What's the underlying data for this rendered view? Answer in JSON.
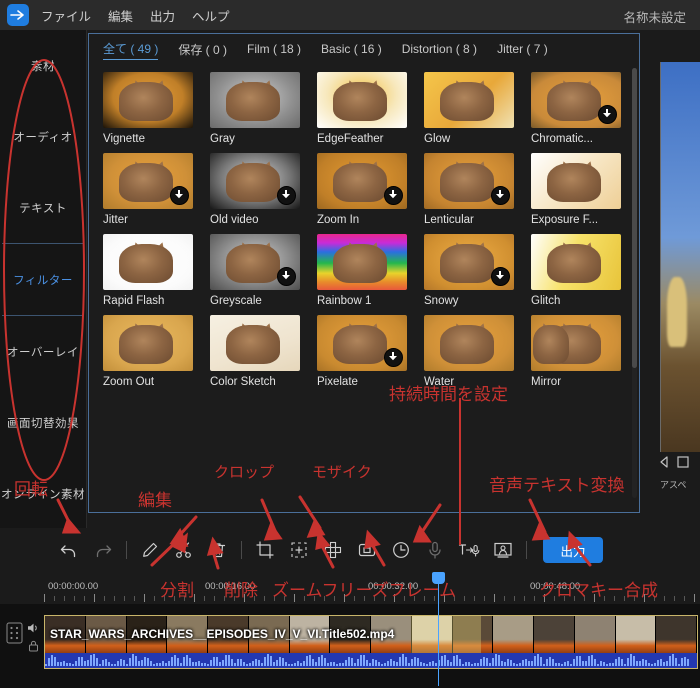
{
  "menubar": {
    "logo_icon": "app-logo-icon",
    "items": [
      "ファイル",
      "編集",
      "出力",
      "ヘルプ"
    ],
    "window_title": "名称未設定"
  },
  "sidebar": {
    "items": [
      {
        "label": "素材",
        "active": false
      },
      {
        "label": "オーディオ",
        "active": false
      },
      {
        "label": "テキスト",
        "active": false
      },
      {
        "label": "フィルター",
        "active": true
      },
      {
        "label": "オーバーレイ",
        "active": false
      },
      {
        "label": "画面切替効果",
        "active": false
      },
      {
        "label": "オンライン素材",
        "active": false
      }
    ]
  },
  "panel": {
    "tabs": [
      {
        "label": "全て ( 49 )",
        "active": true
      },
      {
        "label": "保存 ( 0 )",
        "active": false
      },
      {
        "label": "Film ( 18 )",
        "active": false
      },
      {
        "label": "Basic ( 16 )",
        "active": false
      },
      {
        "label": "Distortion ( 8 )",
        "active": false
      },
      {
        "label": "Jitter ( 7 )",
        "active": false
      }
    ],
    "filters": [
      {
        "label": "Vignette",
        "download": false,
        "style": "vignette"
      },
      {
        "label": "Gray",
        "download": false,
        "style": "gray"
      },
      {
        "label": "EdgeFeather",
        "download": false,
        "style": "edgefeather"
      },
      {
        "label": "Glow",
        "download": false,
        "style": "glow"
      },
      {
        "label": "Chromatic...",
        "download": true,
        "style": "chromatic"
      },
      {
        "label": "Jitter",
        "download": true,
        "style": "jitter"
      },
      {
        "label": "Old video",
        "download": true,
        "style": "oldvideo"
      },
      {
        "label": "Zoom In",
        "download": true,
        "style": "zoomin"
      },
      {
        "label": "Lenticular",
        "download": true,
        "style": "lenticular"
      },
      {
        "label": "Exposure F...",
        "download": false,
        "style": "exposure"
      },
      {
        "label": "Rapid Flash",
        "download": false,
        "style": "rapidflash"
      },
      {
        "label": "Greyscale",
        "download": true,
        "style": "greyscale"
      },
      {
        "label": "Rainbow 1",
        "download": false,
        "style": "rainbow"
      },
      {
        "label": "Snowy",
        "download": true,
        "style": "snowy"
      },
      {
        "label": "Glitch",
        "download": false,
        "style": "glitch"
      },
      {
        "label": "Zoom Out",
        "download": false,
        "style": "zoomout"
      },
      {
        "label": "Color Sketch",
        "download": false,
        "style": "colorsketch"
      },
      {
        "label": "Pixelate",
        "download": true,
        "style": "pixelate"
      },
      {
        "label": "Water",
        "download": false,
        "style": "water"
      },
      {
        "label": "Mirror",
        "download": false,
        "style": "mirror"
      }
    ]
  },
  "preview": {
    "aspect_label": "アスペ"
  },
  "toolbar": {
    "buttons": [
      {
        "icon": "undo-icon",
        "name": "undo-button"
      },
      {
        "icon": "redo-icon",
        "name": "redo-button"
      },
      {
        "icon": "pencil-icon",
        "name": "edit-button"
      },
      {
        "icon": "scissors-icon",
        "name": "split-button"
      },
      {
        "icon": "trash-icon",
        "name": "delete-button"
      },
      {
        "icon": "crop-icon",
        "name": "crop-button"
      },
      {
        "icon": "zoom-pan-icon",
        "name": "zoom-button"
      },
      {
        "icon": "mosaic-icon",
        "name": "mosaic-button"
      },
      {
        "icon": "freeze-frame-icon",
        "name": "freeze-frame-button"
      },
      {
        "icon": "clock-icon",
        "name": "duration-button"
      },
      {
        "icon": "microphone-icon",
        "name": "voiceover-button"
      },
      {
        "icon": "text-to-speech-icon",
        "name": "text-to-speech-button"
      },
      {
        "icon": "chroma-key-icon",
        "name": "chroma-key-button"
      }
    ],
    "export_label": "出力"
  },
  "timeline": {
    "timecodes": [
      "00:00:00.00",
      "00:00:16.00",
      "00:00:32.00",
      "00:00:48.00"
    ],
    "clip_label": "STAR_WARS_ARCHIVES__EPISODES_IV_V_VI.Title502.mp4",
    "track_icons": [
      "track-handle-icon",
      "speaker-icon",
      "lock-icon"
    ]
  },
  "annotations": [
    {
      "text": "回転",
      "name": "annotation-rotate"
    },
    {
      "text": "編集",
      "name": "annotation-edit"
    },
    {
      "text": "分割",
      "name": "annotation-split"
    },
    {
      "text": "削除",
      "name": "annotation-delete"
    },
    {
      "text": "クロップ",
      "name": "annotation-crop"
    },
    {
      "text": "ズームフリーズフレーム",
      "name": "annotation-zoom-freeze-frame"
    },
    {
      "text": "モザイク",
      "name": "annotation-mosaic"
    },
    {
      "text": "持続時間を設定",
      "name": "annotation-set-duration"
    },
    {
      "text": "音声テキスト変換",
      "name": "annotation-speech-to-text"
    },
    {
      "text": "クロマキー合成",
      "name": "annotation-chroma-key"
    }
  ],
  "colors": {
    "accent": "#1f7de0",
    "active_tab": "#5b9bd5",
    "annotation": "#c8332f",
    "panel_border": "#4a6f9a",
    "playhead": "#4aa3ff"
  }
}
